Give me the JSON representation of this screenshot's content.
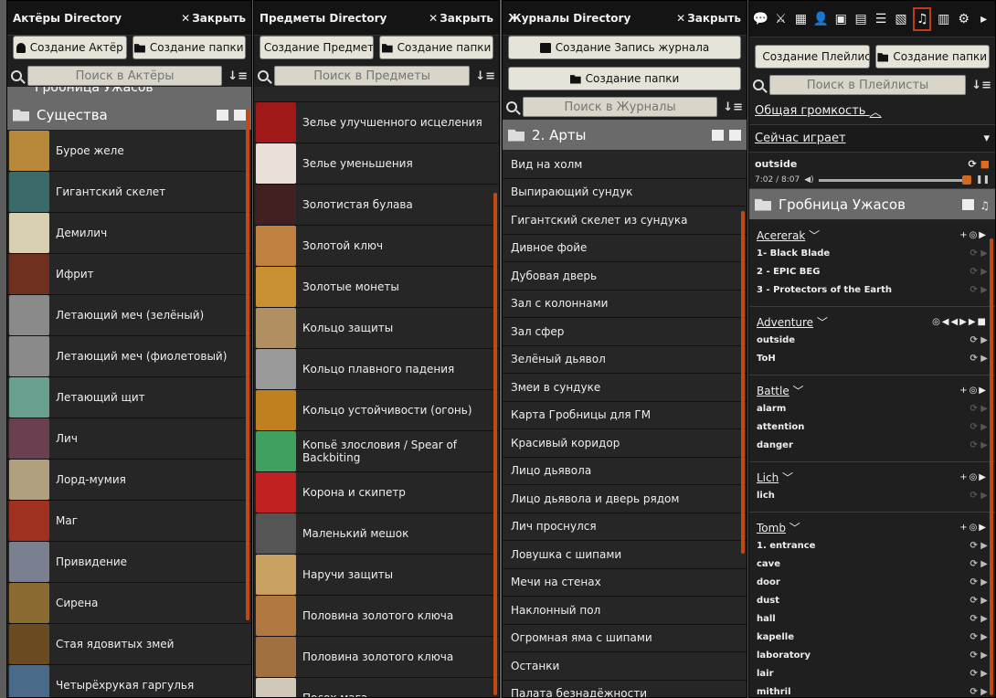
{
  "actors": {
    "title": "Актёры Directory",
    "close": "Закрыть",
    "btn_create": "Создание Актёр",
    "btn_folder": "Создание папки",
    "search_placeholder": "Поиск в Актёры",
    "prev_folder": "Гробница Ужасов",
    "folder": "Существа",
    "items": [
      "Бурое желе",
      "Гигантский скелет",
      "Демилич",
      "Ифрит",
      "Летающий меч (зелёный)",
      "Летающий меч (фиолетовый)",
      "Летающий щит",
      "Лич",
      "Лорд-мумия",
      "Маг",
      "Привидение",
      "Сирена",
      "Стая ядовитых змей",
      "Четырёхрукая гаргулья"
    ],
    "thumb_colors": [
      "#b8893a",
      "#3a6a6a",
      "#d8d0b0",
      "#703020",
      "#8a8a8a",
      "#8a8a8a",
      "#6aa090",
      "#6a4050",
      "#b0a080",
      "#a03020",
      "#7a8090",
      "#8a6a30",
      "#6a4a20",
      "#4a6a8a"
    ]
  },
  "items": {
    "title": "Предметы Directory",
    "close": "Закрыть",
    "btn_create": "Создание Предмет",
    "btn_folder": "Создание папки",
    "search_placeholder": "Поиск в Предметы",
    "items": [
      "Зелье улучшенного исцеления",
      "Зелье уменьшения",
      "Золотистая булава",
      "Золотой ключ",
      "Золотые монеты",
      "Кольцо защиты",
      "Кольцо плавного падения",
      "Кольцо устойчивости (огонь)",
      "Копьё злословия / Spear of Backbiting",
      "Корона и скипетр",
      "Маленький мешок",
      "Наручи защиты",
      "Половина золотого ключа",
      "Половина золотого ключа",
      "Посох мага"
    ],
    "thumb_colors": [
      "#a01818",
      "#e8e0d8",
      "#402020",
      "#c08040",
      "#c89030",
      "#b09060",
      "#9a9a9a",
      "#c08020",
      "#40a060",
      "#c02020",
      "#555555",
      "#c8a060",
      "#b07840",
      "#a07040",
      "#d0c8b8"
    ]
  },
  "journals": {
    "title": "Журналы Directory",
    "close": "Закрыть",
    "btn_create": "Создание Запись журнала",
    "btn_folder": "Создание папки",
    "search_placeholder": "Поиск в Журналы",
    "folder": "2. Арты",
    "items": [
      "Вид на холм",
      "Выпирающий сундук",
      "Гигантский скелет из сундука",
      "Дивное фойе",
      "Дубовая дверь",
      "Зал с колоннами",
      "Зал сфер",
      "Зелёный дьявол",
      "Змеи в сундуке",
      "Карта Гробницы для ГМ",
      "Красивый коридор",
      "Лицо дьявола",
      "Лицо дьявола и дверь рядом",
      "Лич проснулся",
      "Ловушка с шипами",
      "Мечи на стенах",
      "Наклонный пол",
      "Огромная яма с шипами",
      "Останки",
      "Палата безнадёжности"
    ]
  },
  "playlists": {
    "tabs": [
      "chat-icon",
      "combat-icon",
      "scenes-icon",
      "actors-icon",
      "items-icon",
      "journal-icon",
      "tables-icon",
      "cards-icon",
      "playlists-icon",
      "compendium-icon",
      "settings-icon",
      "collapse-icon"
    ],
    "btn_create": "Создание Плейлист",
    "btn_folder": "Создание папки",
    "search_placeholder": "Поиск в Плейлисты",
    "volume_label": "Общая громкость",
    "now_playing": "Сейчас играет",
    "now_track": "outside",
    "now_time": "7:02 / 8:07",
    "folder": "Гробница Ужасов",
    "groups": [
      {
        "name": "Acererak",
        "tracks": [
          "1- Black Blade",
          "2 - EPIC BEG",
          "3 - Protectors of the Earth"
        ]
      },
      {
        "name": "Adventure",
        "tracks": [
          "outside",
          "ToH"
        ]
      },
      {
        "name": "Battle",
        "tracks": [
          "alarm",
          "attention",
          "danger"
        ]
      },
      {
        "name": "Lich",
        "tracks": [
          "lich"
        ]
      },
      {
        "name": "Tomb",
        "tracks": [
          "1. entrance",
          "cave",
          "door",
          "dust",
          "hall",
          "kapelle",
          "laboratory",
          "lair",
          "mithril"
        ]
      }
    ]
  }
}
